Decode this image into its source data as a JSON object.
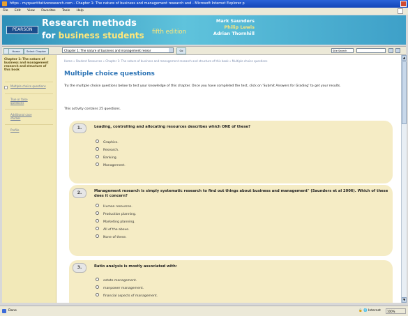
{
  "browser": {
    "title": "https - myquantitativeresearch.com - Chapter 1: The nature of business and management research and - Microsoft Internet Explorer p",
    "menu": [
      "File",
      "Edit",
      "View",
      "Favorites",
      "Tools",
      "Help"
    ],
    "status": "Done",
    "zone": "Internet",
    "zoom": "100%"
  },
  "banner": {
    "logo": "PEARSON",
    "title_line1": "Research methods",
    "title_line2_prefix": "for ",
    "title_line2_highlight": "business students",
    "edition": "fifth edition",
    "authors": [
      "Mark Saunders",
      "Philip Lewis",
      "Adrian Thornhill"
    ]
  },
  "toolbar": {
    "home": "Home",
    "select_chapter": "Select Chapter",
    "chapter": "Chapter 1: The nature of business and management resear",
    "go": "Go",
    "site_search": "Site Search"
  },
  "sidebar": {
    "heading": "Chapter 1: The nature of business and management research and structure of this book",
    "items": [
      "Multiple choice questions",
      "True or false questions",
      "Additional case studies",
      "Profile"
    ]
  },
  "main": {
    "breadcrumb": "Home  »  Student Resources  »  Chapter 1: The nature of business and management research and structure of this book  »  Multiple choice questions",
    "heading": "Multiple choice questions",
    "intro": "Try the multiple choice questions below to test your knowledge of this chapter. Once you have completed the test, click on 'Submit Answers for Grading' to get your results.",
    "activity_count": "This activity contains 25 questions.",
    "questions": [
      {
        "num": "1.",
        "text": "Leading, controlling and allocating resources describes which ONE of these?",
        "options": [
          "Graphics.",
          "Research.",
          "Banking.",
          "Management."
        ]
      },
      {
        "num": "2.",
        "text": "Management research is simply systematic research to find out things about business and management\" (Saunders et al 2006). Which of these does it concern?",
        "options": [
          "Human resources.",
          "Production planning.",
          "Marketing planning.",
          "All of the above.",
          "None of these."
        ]
      },
      {
        "num": "3.",
        "text": "Ratio analysis is mostly associated with:",
        "options": [
          "estate management.",
          "manpower management.",
          "financial aspects of management."
        ]
      }
    ]
  }
}
